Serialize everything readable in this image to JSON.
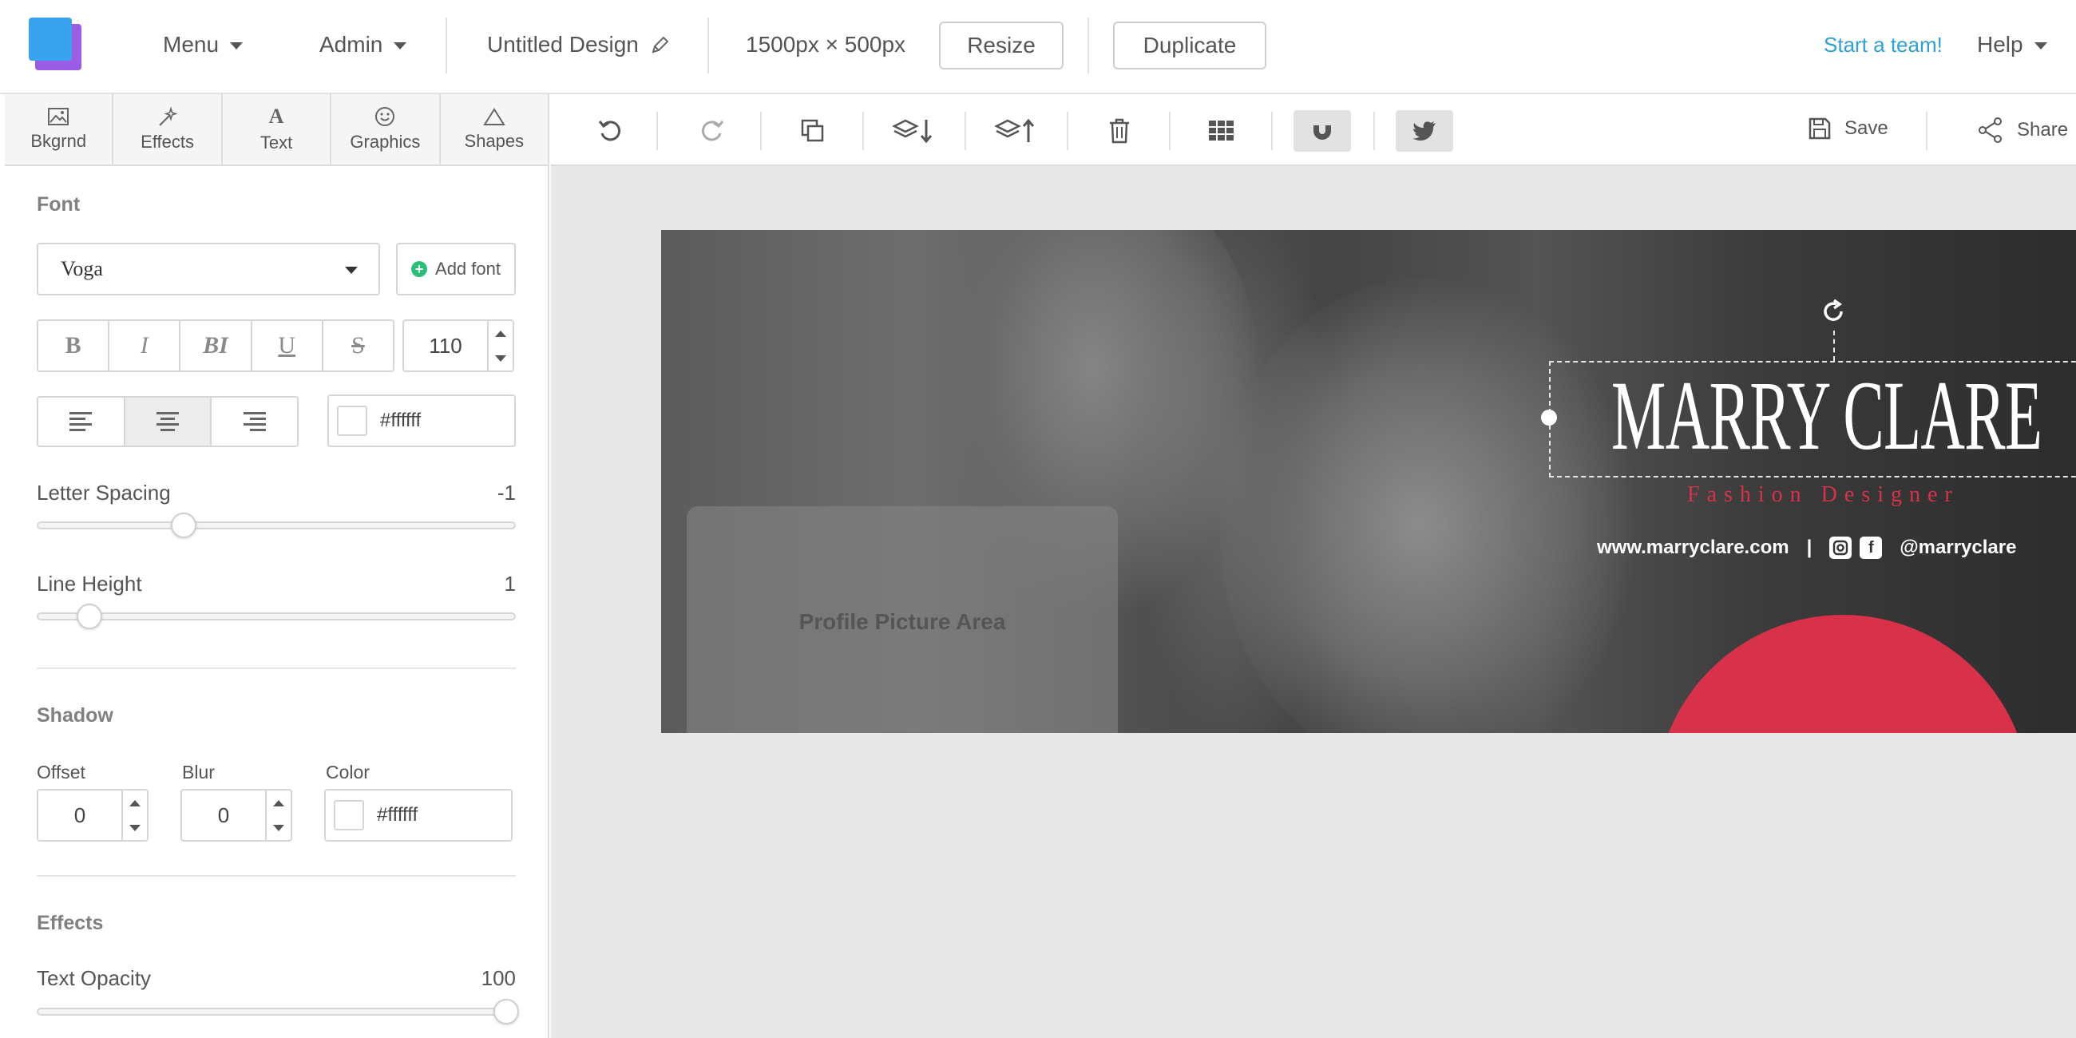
{
  "topbar": {
    "menu_label": "Menu",
    "admin_label": "Admin",
    "design_title": "Untitled Design",
    "dimensions": "1500px × 500px",
    "resize_label": "Resize",
    "duplicate_label": "Duplicate",
    "team_link": "Start a team!",
    "help_label": "Help"
  },
  "tool_tabs": [
    {
      "label": "Bkgrnd",
      "icon": "image-icon"
    },
    {
      "label": "Effects",
      "icon": "magic-wand-icon"
    },
    {
      "label": "Text",
      "icon": "text-icon"
    },
    {
      "label": "Graphics",
      "icon": "smiley-icon"
    },
    {
      "label": "Shapes",
      "icon": "triangle-icon"
    }
  ],
  "font": {
    "section_title": "Font",
    "font_name": "Voga",
    "add_font_label": "Add font",
    "style_buttons": [
      "B",
      "I",
      "BI",
      "U",
      "S"
    ],
    "size": "110",
    "color": "#ffffff",
    "active_alignment": "center"
  },
  "letter_spacing": {
    "label": "Letter Spacing",
    "value": "-1",
    "fraction": 0.31
  },
  "line_height": {
    "label": "Line Height",
    "value": "1",
    "fraction": 0.11
  },
  "shadow": {
    "section_title": "Shadow",
    "offset_label": "Offset",
    "offset_value": "0",
    "blur_label": "Blur",
    "blur_value": "0",
    "color_label": "Color",
    "color_value": "#ffffff"
  },
  "effects": {
    "section_title": "Effects",
    "opacity_label": "Text Opacity",
    "opacity_value": "100"
  },
  "toolbar": {
    "tools": [
      "undo-icon",
      "redo-icon",
      "copy-icon",
      "send-backward-icon",
      "bring-forward-icon",
      "trash-icon",
      "grid-icon",
      "magnet-icon",
      "twitter-icon"
    ],
    "save_label": "Save",
    "share_label": "Share"
  },
  "canvas": {
    "profile_label": "Profile Picture Area",
    "brand_name": "MARRY CLARE",
    "subtitle": "Fashion Designer",
    "website": "www.marryclare.com",
    "separator": "|",
    "handle": "@marryclare",
    "accent_color": "#d8324a"
  }
}
